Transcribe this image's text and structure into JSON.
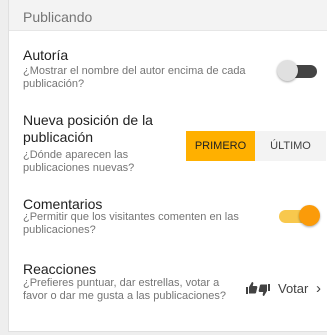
{
  "section": {
    "title": "Publicando"
  },
  "authorship": {
    "title": "Autoría",
    "description": "¿Mostrar el nombre del autor encima de cada publicación?",
    "enabled": false
  },
  "new_post_position": {
    "title": "Nueva posición de la publicación",
    "description": "¿Dónde aparecen las publicaciones nuevas?",
    "options": [
      "PRIMERO",
      "ÚLTIMO"
    ],
    "selected": "PRIMERO"
  },
  "comments": {
    "title": "Comentarios",
    "description": "¿Permitir que los visitantes comenten en las publicaciones?",
    "enabled": true
  },
  "reactions": {
    "title": "Reacciones",
    "description": "¿Prefieres puntuar, dar estrellas, votar a favor o dar me gusta a las publicaciones?",
    "value": "Votar",
    "icon": "thumbs-up-down-icon",
    "chevron": "›"
  },
  "colors": {
    "accent": "#ffb000",
    "toggle_on_thumb": "#fb9b09",
    "toggle_on_track": "#f8c84d",
    "toggle_off_track": "#444444"
  }
}
